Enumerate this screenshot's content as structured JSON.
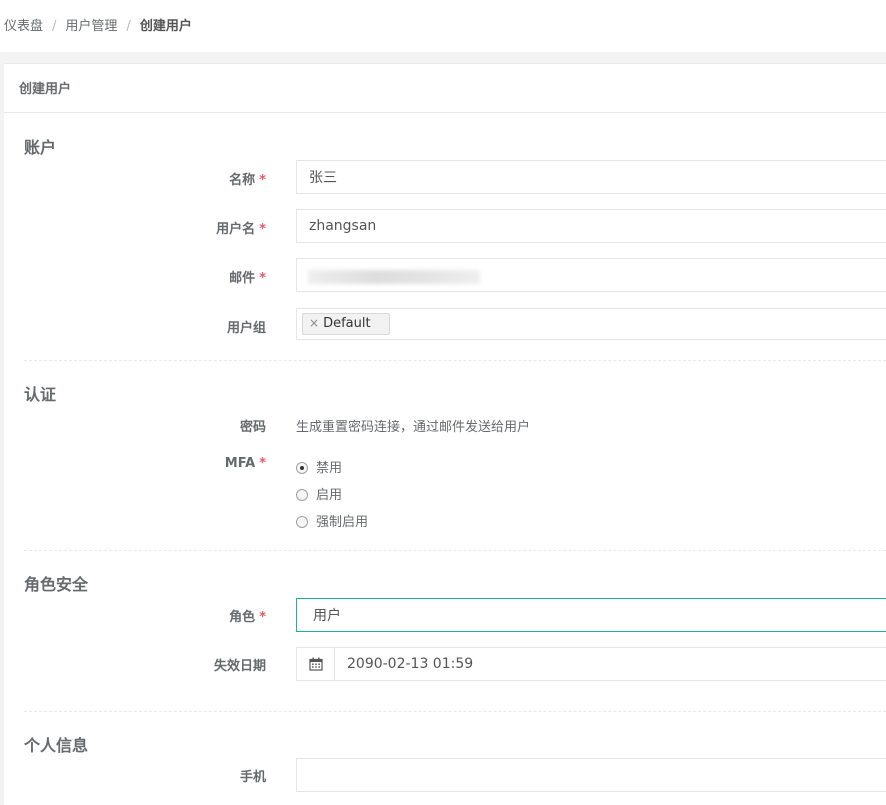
{
  "breadcrumb": {
    "items": [
      "仪表盘",
      "用户管理"
    ],
    "active": "创建用户",
    "separator": "/"
  },
  "panel": {
    "title": "创建用户"
  },
  "sections": {
    "account": "账户",
    "auth": "认证",
    "role_security": "角色安全",
    "personal": "个人信息"
  },
  "fields": {
    "name": {
      "label": "名称",
      "value": "张三"
    },
    "username": {
      "label": "用户名",
      "value": "zhangsan"
    },
    "email": {
      "label": "邮件",
      "value": ""
    },
    "groups": {
      "label": "用户组",
      "tag": "Default",
      "remove_symbol": "×"
    },
    "password": {
      "label": "密码",
      "text": "生成重置密码连接，通过邮件发送给用户"
    },
    "mfa": {
      "label": "MFA",
      "options": [
        "禁用",
        "启用",
        "强制启用"
      ],
      "selected": "禁用"
    },
    "role": {
      "label": "角色",
      "value": "用户"
    },
    "expire": {
      "label": "失效日期",
      "value": "2090-02-13 01:59",
      "icon": "calendar-icon"
    },
    "phone": {
      "label": "手机",
      "value": ""
    }
  },
  "required_mark": "*",
  "colors": {
    "accent": "#1ab394",
    "required": "#ed5565"
  }
}
